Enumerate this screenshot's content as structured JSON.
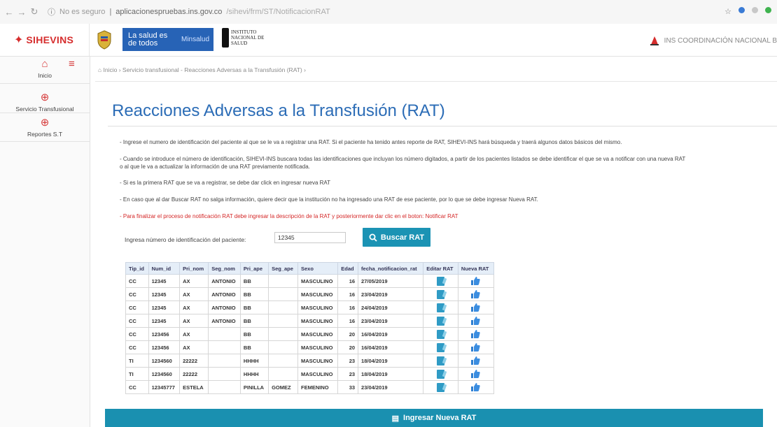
{
  "browser": {
    "security": "No es seguro",
    "host": "aplicacionespruebas.ins.gov.co",
    "path": "/sihevi/frm/ST/NotificacionRAT"
  },
  "header": {
    "brand": "SIHEVINS",
    "gov_line1": "La salud es de todos",
    "gov_line2": "Minsalud",
    "ins_line1": "INSTITUTO",
    "ins_line2": "NACIONAL DE",
    "ins_line3": "SALUD",
    "right_text": "INS COORDINACIÓN NACIONAL B"
  },
  "sidebar": {
    "items": [
      {
        "label": "Inicio",
        "icon": "home-icon"
      },
      {
        "label": "Servicio Transfusional",
        "icon": "plus-circle-icon"
      },
      {
        "label": "Reportes S.T",
        "icon": "plus-circle-icon"
      }
    ]
  },
  "breadcrumb": "Inicio  ›  Servicio transfusional - Reacciones Adversas a la Transfusión (RAT)  ›",
  "page_title": "Reacciones Adversas a la Transfusión (RAT)",
  "paragraphs": [
    "- Ingrese el numero de identificación del paciente al que se le va a registrar una RAT. Si el paciente ha tenido antes reporte de RAT, SIHEVI-INS hará búsqueda y traerá algunos datos básicos del mismo.",
    "- Cuando se introduce el número de identificación, SIHEVI-INS buscara todas las identificaciones que incluyan los número digitados, a partir de los pacientes listados se debe identificar el que se va a notificar con una nueva RAT",
    "o al que le va a actualizar la información de una RAT previamente notificada.",
    "- Si es la primera RAT que se va a registrar, se debe dar click en ingresar nueva RAT",
    "- En caso que al dar Buscar RAT no salga información, quiere decir que la institución no ha ingresado una RAT de ese paciente, por lo que se debe ingresar Nueva RAT.",
    "- Para finalizar el proceso de notificación RAT debe ingresar la descripción de la RAT y posteriormente dar clic en el boton: Notificar RAT"
  ],
  "search": {
    "label": "Ingresa número de identificación del paciente:",
    "value": "12345",
    "button": "Buscar RAT"
  },
  "table": {
    "headers": [
      "Tip_id",
      "Num_id",
      "Pri_nom",
      "Seg_nom",
      "Pri_ape",
      "Seg_ape",
      "Sexo",
      "Edad",
      "fecha_notificacion_rat",
      "Editar RAT",
      "Nueva RAT"
    ],
    "rows": [
      [
        "CC",
        "12345",
        "AX",
        "ANTONIO",
        "BB",
        "",
        "MASCULINO",
        "16",
        "27/05/2019"
      ],
      [
        "CC",
        "12345",
        "AX",
        "ANTONIO",
        "BB",
        "",
        "MASCULINO",
        "16",
        "23/04/2019"
      ],
      [
        "CC",
        "12345",
        "AX",
        "ANTONIO",
        "BB",
        "",
        "MASCULINO",
        "16",
        "24/04/2019"
      ],
      [
        "CC",
        "12345",
        "AX",
        "ANTONIO",
        "BB",
        "",
        "MASCULINO",
        "16",
        "23/04/2019"
      ],
      [
        "CC",
        "123456",
        "AX",
        "",
        "BB",
        "",
        "MASCULINO",
        "20",
        "16/04/2019"
      ],
      [
        "CC",
        "123456",
        "AX",
        "",
        "BB",
        "",
        "MASCULINO",
        "20",
        "16/04/2019"
      ],
      [
        "TI",
        "1234560",
        "22222",
        "",
        "HHHH",
        "",
        "MASCULINO",
        "23",
        "18/04/2019"
      ],
      [
        "TI",
        "1234560",
        "22222",
        "",
        "HHHH",
        "",
        "MASCULINO",
        "23",
        "18/04/2019"
      ],
      [
        "CC",
        "12345777",
        "ESTELA",
        "",
        "PINILLA",
        "GOMEZ",
        "FEMENINO",
        "33",
        "23/04/2019"
      ]
    ]
  },
  "footer_button": "Ingresar Nueva RAT",
  "colors": {
    "accent": "#1a90b0",
    "title": "#2b6cb6",
    "brand": "#d62d2d",
    "warning": "#d42626"
  }
}
